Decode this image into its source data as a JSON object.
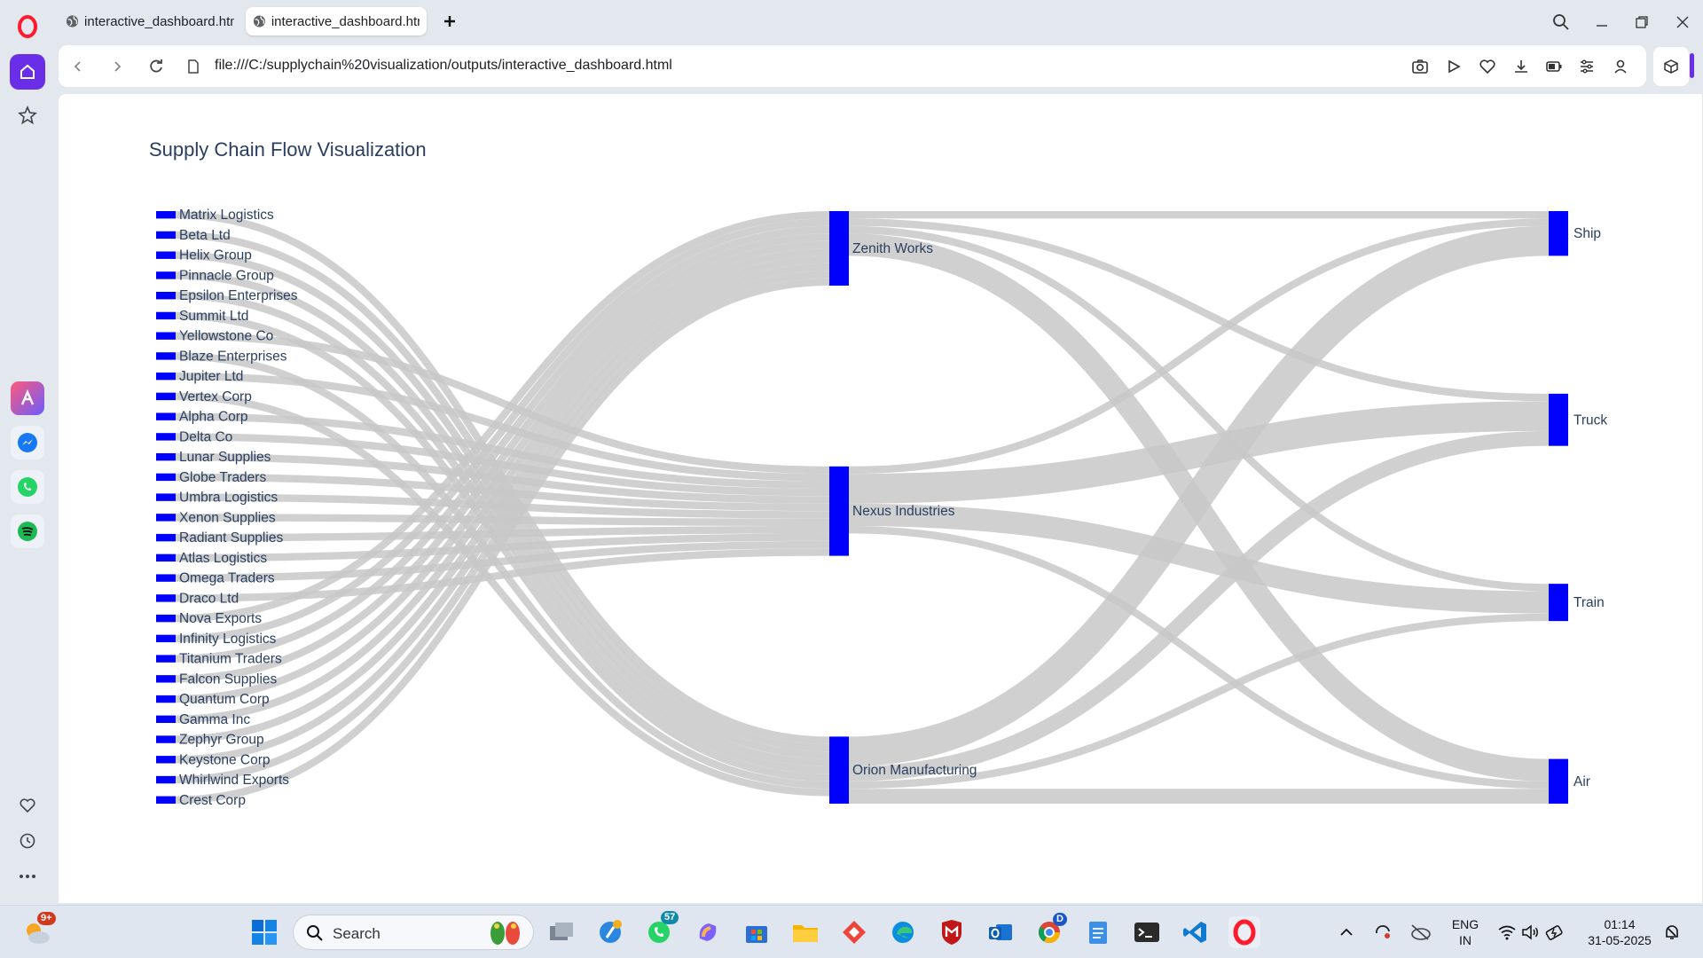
{
  "browser": {
    "tabs": [
      {
        "label": "interactive_dashboard.html",
        "active": false
      },
      {
        "label": "interactive_dashboard.html",
        "active": true
      }
    ],
    "url": "file:///C:/supplychain%20visualization/outputs/interactive_dashboard.html",
    "accent_color": "#6b2ee8"
  },
  "sidebar": {
    "items": [
      "opera-logo",
      "home-icon",
      "star-icon",
      "aria-icon",
      "messenger-icon",
      "whatsapp-icon",
      "spotify-icon",
      "heart-icon",
      "history-icon",
      "more-icon"
    ]
  },
  "chart_data": {
    "type": "sankey",
    "title": "Supply Chain Flow Visualization",
    "node_color": "#0000ff",
    "link_color": "#c8c8c8",
    "suppliers": [
      "Matrix Logistics",
      "Beta Ltd",
      "Helix Group",
      "Pinnacle Group",
      "Epsilon Enterprises",
      "Summit Ltd",
      "Yellowstone Co",
      "Blaze Enterprises",
      "Jupiter Ltd",
      "Vertex Corp",
      "Alpha Corp",
      "Delta Co",
      "Lunar Supplies",
      "Globe Traders",
      "Umbra Logistics",
      "Xenon Supplies",
      "Radiant Supplies",
      "Atlas Logistics",
      "Omega Traders",
      "Draco Ltd",
      "Nova Exports",
      "Infinity Logistics",
      "Titanium Traders",
      "Falcon Supplies",
      "Quantum Corp",
      "Gamma Inc",
      "Zephyr Group",
      "Keystone Corp",
      "Whirlwind Exports",
      "Crest Corp"
    ],
    "manufacturers": [
      "Zenith Works",
      "Nexus Industries",
      "Orion Manufacturing"
    ],
    "transport_modes": [
      "Ship",
      "Truck",
      "Train",
      "Air"
    ],
    "supplier_to_manufacturer": [
      {
        "source": "Matrix Logistics",
        "target": "Orion Manufacturing",
        "value": 1
      },
      {
        "source": "Beta Ltd",
        "target": "Orion Manufacturing",
        "value": 1
      },
      {
        "source": "Helix Group",
        "target": "Orion Manufacturing",
        "value": 1
      },
      {
        "source": "Pinnacle Group",
        "target": "Orion Manufacturing",
        "value": 1
      },
      {
        "source": "Epsilon Enterprises",
        "target": "Orion Manufacturing",
        "value": 1
      },
      {
        "source": "Summit Ltd",
        "target": "Orion Manufacturing",
        "value": 1
      },
      {
        "source": "Yellowstone Co",
        "target": "Nexus Industries",
        "value": 1
      },
      {
        "source": "Blaze Enterprises",
        "target": "Orion Manufacturing",
        "value": 1
      },
      {
        "source": "Jupiter Ltd",
        "target": "Nexus Industries",
        "value": 1
      },
      {
        "source": "Vertex Corp",
        "target": "Orion Manufacturing",
        "value": 1
      },
      {
        "source": "Alpha Corp",
        "target": "Nexus Industries",
        "value": 1
      },
      {
        "source": "Delta Co",
        "target": "Nexus Industries",
        "value": 1
      },
      {
        "source": "Lunar Supplies",
        "target": "Nexus Industries",
        "value": 1
      },
      {
        "source": "Globe Traders",
        "target": "Nexus Industries",
        "value": 1
      },
      {
        "source": "Umbra Logistics",
        "target": "Nexus Industries",
        "value": 1
      },
      {
        "source": "Xenon Supplies",
        "target": "Nexus Industries",
        "value": 1
      },
      {
        "source": "Radiant Supplies",
        "target": "Nexus Industries",
        "value": 1
      },
      {
        "source": "Atlas Logistics",
        "target": "Nexus Industries",
        "value": 1
      },
      {
        "source": "Omega Traders",
        "target": "Nexus Industries",
        "value": 1
      },
      {
        "source": "Draco Ltd",
        "target": "Nexus Industries",
        "value": 1
      },
      {
        "source": "Nova Exports",
        "target": "Zenith Works",
        "value": 1
      },
      {
        "source": "Infinity Logistics",
        "target": "Zenith Works",
        "value": 1
      },
      {
        "source": "Titanium Traders",
        "target": "Zenith Works",
        "value": 1
      },
      {
        "source": "Falcon Supplies",
        "target": "Zenith Works",
        "value": 1
      },
      {
        "source": "Quantum Corp",
        "target": "Zenith Works",
        "value": 1
      },
      {
        "source": "Gamma Inc",
        "target": "Zenith Works",
        "value": 1
      },
      {
        "source": "Zephyr Group",
        "target": "Zenith Works",
        "value": 1
      },
      {
        "source": "Keystone Corp",
        "target": "Zenith Works",
        "value": 1
      },
      {
        "source": "Whirlwind Exports",
        "target": "Zenith Works",
        "value": 1
      },
      {
        "source": "Crest Corp",
        "target": "Zenith Works",
        "value": 1
      }
    ],
    "manufacturer_to_transport": [
      {
        "source": "Zenith Works",
        "target": "Ship",
        "value": 1
      },
      {
        "source": "Zenith Works",
        "target": "Truck",
        "value": 1
      },
      {
        "source": "Zenith Works",
        "target": "Train",
        "value": 1
      },
      {
        "source": "Zenith Works",
        "target": "Air",
        "value": 3
      },
      {
        "source": "Nexus Industries",
        "target": "Truck",
        "value": 4
      },
      {
        "source": "Nexus Industries",
        "target": "Train",
        "value": 3
      },
      {
        "source": "Nexus Industries",
        "target": "Air",
        "value": 1
      },
      {
        "source": "Nexus Industries",
        "target": "Ship",
        "value": 1
      },
      {
        "source": "Orion Manufacturing",
        "target": "Ship",
        "value": 4
      },
      {
        "source": "Orion Manufacturing",
        "target": "Truck",
        "value": 2
      },
      {
        "source": "Orion Manufacturing",
        "target": "Train",
        "value": 1
      },
      {
        "source": "Orion Manufacturing",
        "target": "Air",
        "value": 2
      }
    ]
  },
  "taskbar": {
    "search_placeholder": "Search",
    "language": "ENG",
    "region": "IN",
    "time": "01:14",
    "date": "31-05-2025",
    "widget_badge": "9+",
    "whatsapp_badge": "57",
    "chrome_badge": "D"
  }
}
